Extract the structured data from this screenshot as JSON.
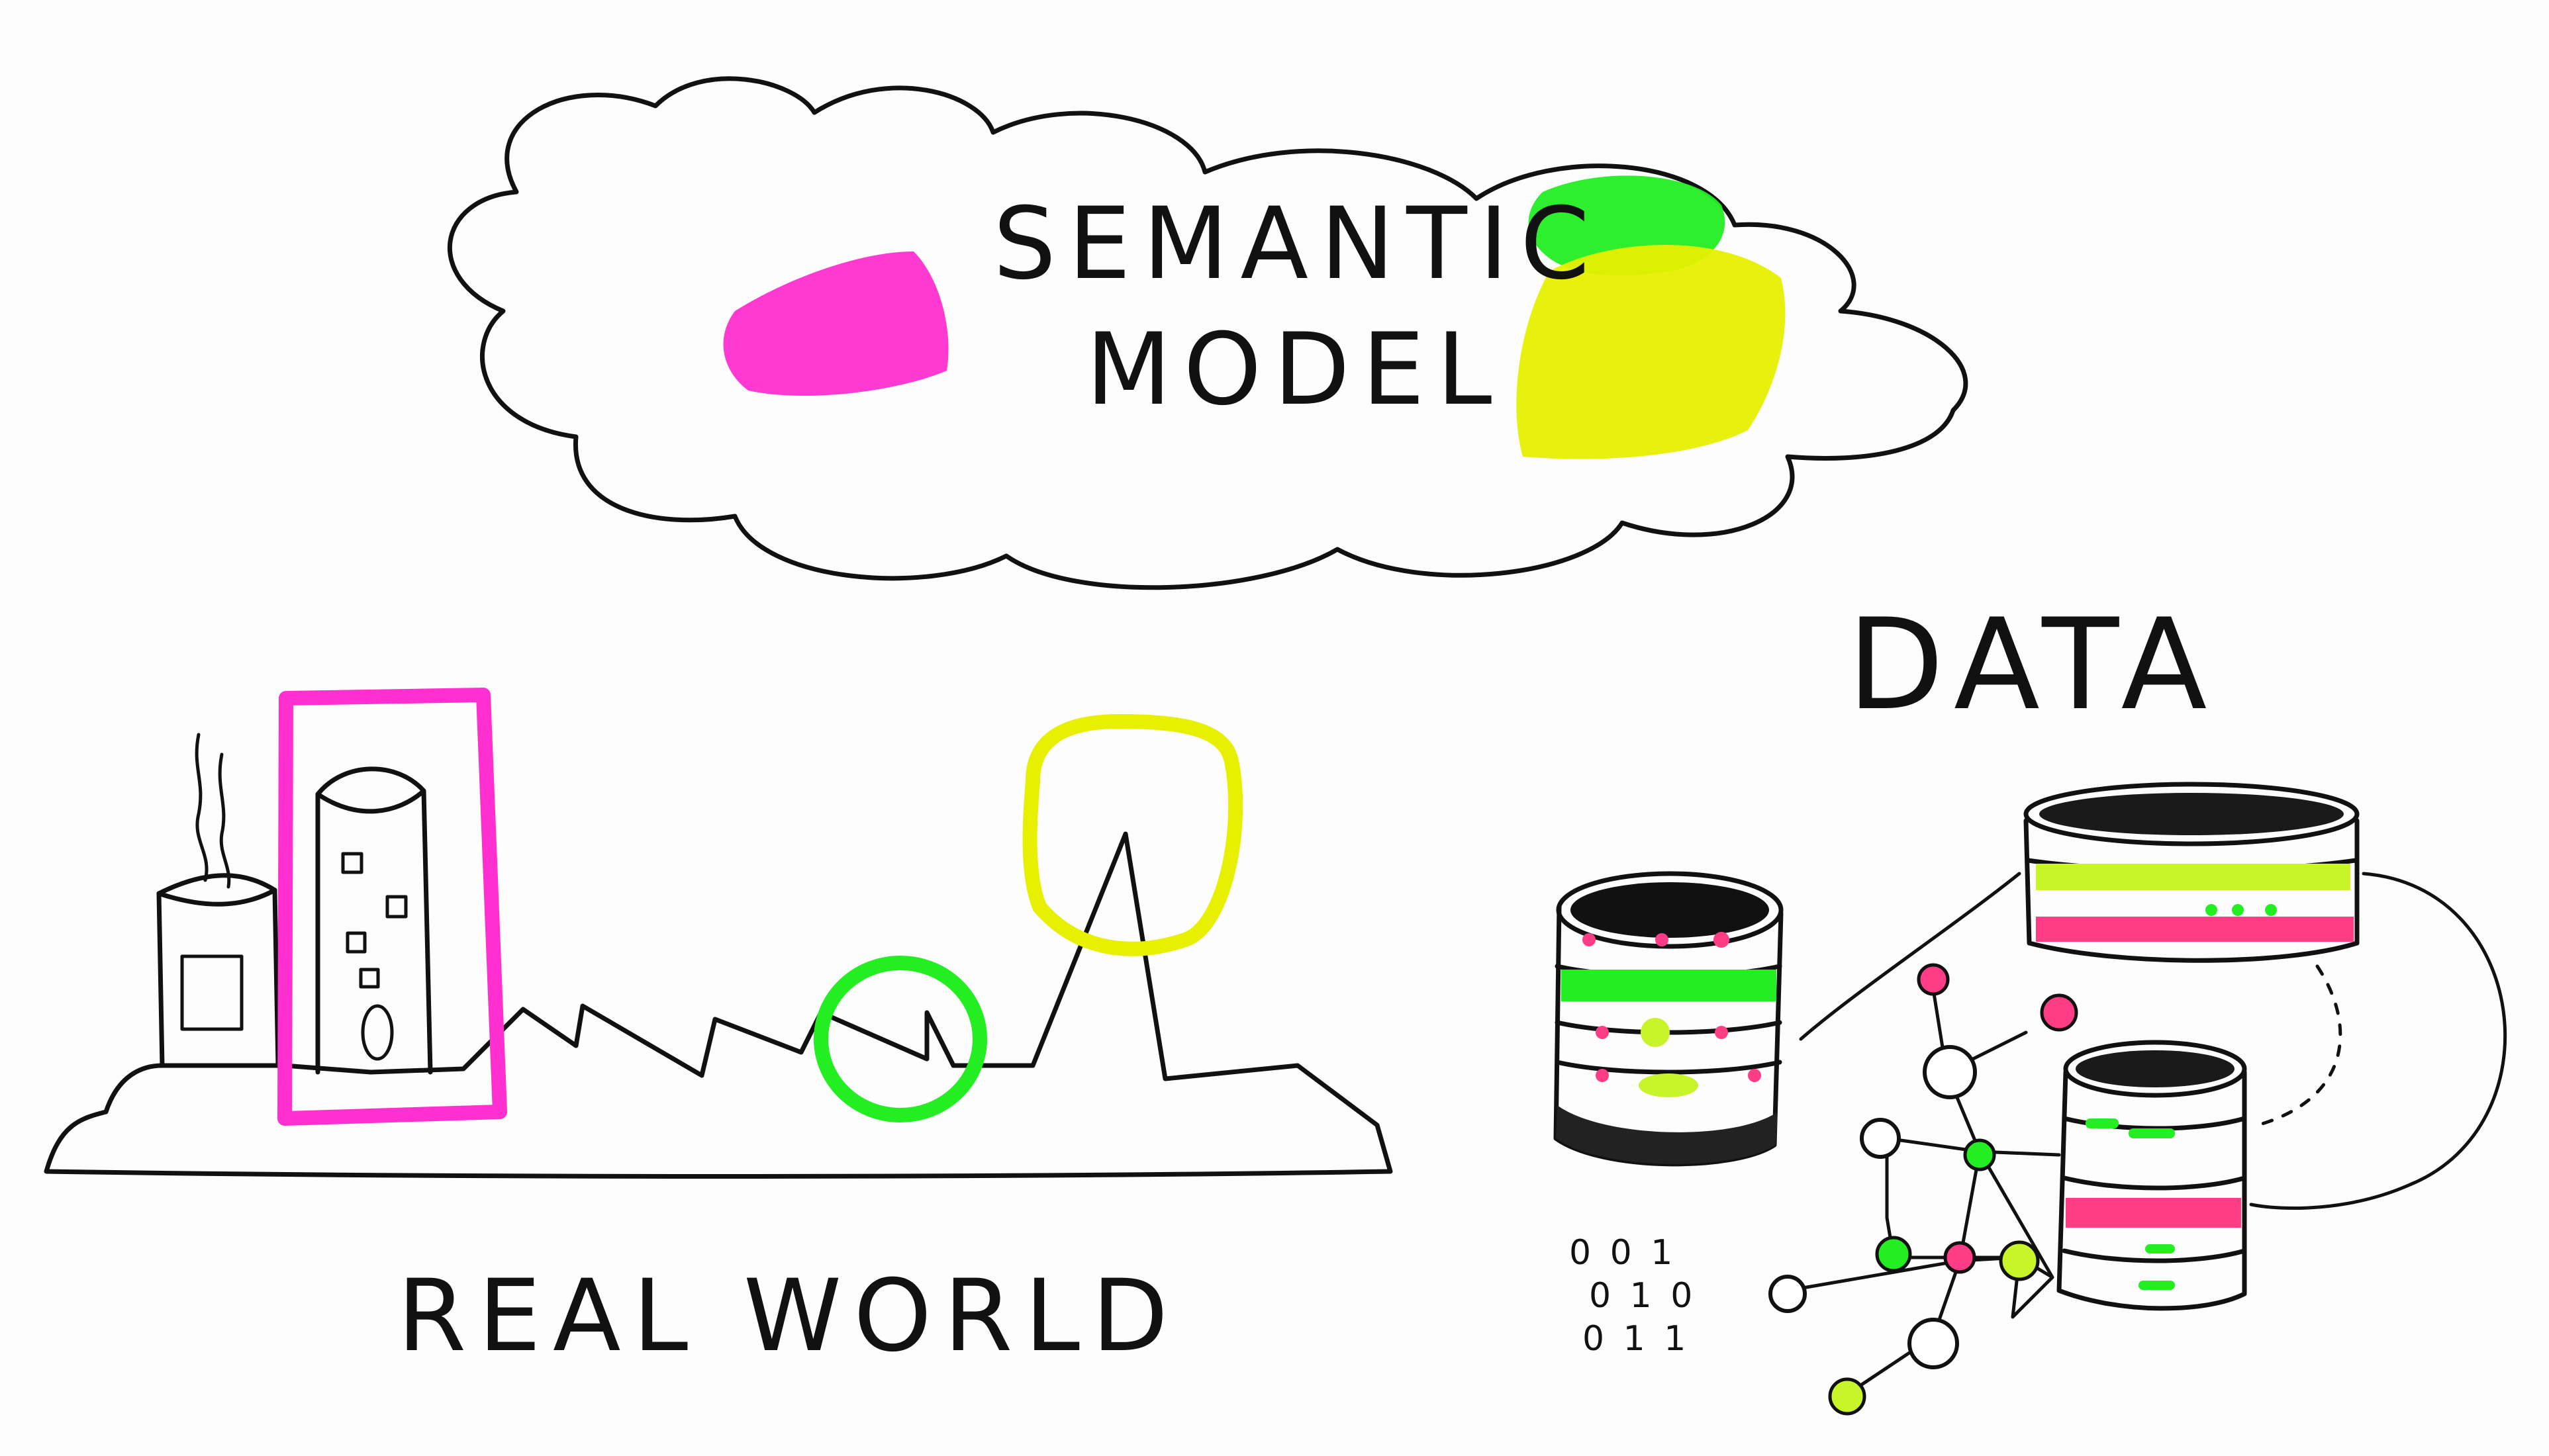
{
  "labels": {
    "semantic_line1": "SEMANTIC",
    "semantic_line2": "MODEL",
    "data": "DATA",
    "real_world": "REAL WORLD",
    "binary_row1": "0 0 1",
    "binary_row2": "0 1 0",
    "binary_row3": "0 1 1"
  },
  "colors": {
    "ink": "#111111",
    "magenta": "#ff2fd0",
    "green": "#22ee22",
    "yellow": "#e6f000",
    "pink_band": "#ff3d86",
    "lime_band": "#c8f52a"
  }
}
